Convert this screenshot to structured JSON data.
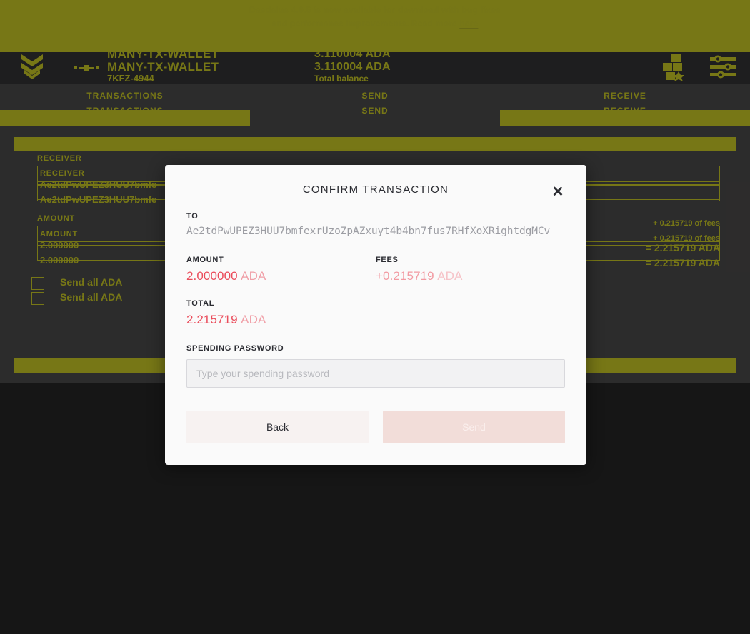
{
  "news_banner": {
    "line1": "Daedalus 4.0.5 is now available for download with bug fixes",
    "line2": "and performance improvements. Read more",
    "link_label": "here",
    "background": "#ffff00",
    "text_color": "#fbfb05"
  },
  "topbar": {
    "logo_icon": "cardano-chevron-logo",
    "link_icon": "network-link-icon",
    "wallet_name": "MANY-TX-WALLET",
    "wallet_sub": "7KFZ-4944",
    "balance_amount": "3.110004 ADA",
    "balance_sub": "Total balance",
    "wallets_icon": "wallets-grid-icon",
    "settings_icon": "settings-sliders-icon",
    "background": "#17171a",
    "accent": "#ffff00"
  },
  "tabs": [
    {
      "label": "TRANSACTIONS",
      "active": false
    },
    {
      "label": "SEND",
      "active": true
    },
    {
      "label": "RECEIVE",
      "active": false
    }
  ],
  "send_form": {
    "receiver_label": "RECEIVER",
    "receiver_value": "Ae2tdPwUPEZ3HUU7bmfe",
    "amount_label": "AMOUNT",
    "amount_value": "2.000000",
    "send_all_label": "Send all ADA",
    "fee_note": "+ 0.215719 of fees",
    "total_note": "= 2.215719 ADA",
    "submit_label": "Send",
    "background": "#3b3a3a",
    "accent": "#ffff00"
  },
  "modal": {
    "title": "CONFIRM TRANSACTION",
    "close_icon": "close-icon",
    "to_label": "TO",
    "to_address": "Ae2tdPwUPEZ3HUU7bmfexrUzoZpAZxuyt4b4bn7fus7RHfXoXRightdgMCv",
    "amount_label": "AMOUNT",
    "amount_value": "2.000000",
    "amount_unit": "ADA",
    "fees_label": "FEES",
    "fees_value": "+0.215719",
    "fees_unit": "ADA",
    "total_label": "TOTAL",
    "total_value": "2.215719",
    "total_unit": "ADA",
    "password_label": "SPENDING PASSWORD",
    "password_value": "",
    "password_placeholder": "Type your spending password",
    "back_label": "Back",
    "send_label": "Send",
    "amount_color": "#ea4c5b",
    "fees_color": "#f29aa2",
    "background": "#fafafa"
  }
}
